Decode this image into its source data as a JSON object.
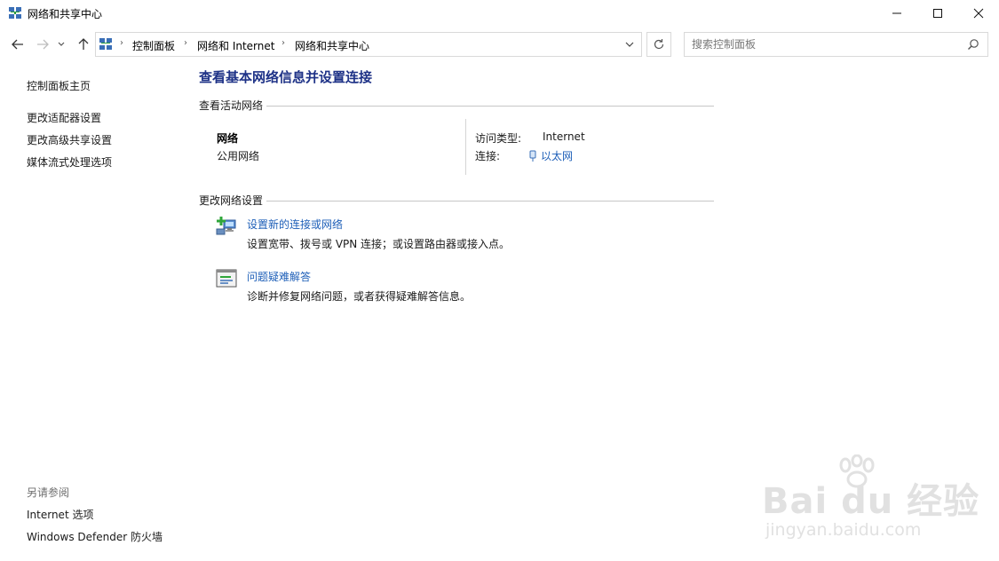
{
  "window": {
    "title": "网络和共享中心",
    "controls": {
      "minimize": "minimize-icon",
      "maximize": "maximize-icon",
      "close": "close-icon"
    }
  },
  "addressbar": {
    "breadcrumbs": [
      "控制面板",
      "网络和 Internet",
      "网络和共享中心"
    ]
  },
  "search": {
    "placeholder": "搜索控制面板"
  },
  "leftnav": {
    "items": [
      "控制面板主页",
      "更改适配器设置",
      "更改高级共享设置",
      "媒体流式处理选项"
    ]
  },
  "seealso": {
    "title": "另请参阅",
    "items": [
      "Internet 选项",
      "Windows Defender 防火墙"
    ]
  },
  "main": {
    "title": "查看基本网络信息并设置连接",
    "active_section": "查看活动网络",
    "network": {
      "name": "网络",
      "profile": "公用网络",
      "access_label": "访问类型:",
      "access_value": "Internet",
      "conn_label": "连接:",
      "conn_value": "以太网"
    },
    "change_section": "更改网络设置",
    "tasks": [
      {
        "title": "设置新的连接或网络",
        "desc": "设置宽带、拨号或 VPN 连接；或设置路由器或接入点。"
      },
      {
        "title": "问题疑难解答",
        "desc": "诊断并修复网络问题，或者获得疑难解答信息。"
      }
    ]
  },
  "watermark": {
    "brand": "Bai du 经验",
    "url": "jingyan.baidu.com"
  },
  "colors": {
    "link": "#1e5fb8",
    "heading": "#1e3287",
    "border": "#d9d9d9"
  }
}
